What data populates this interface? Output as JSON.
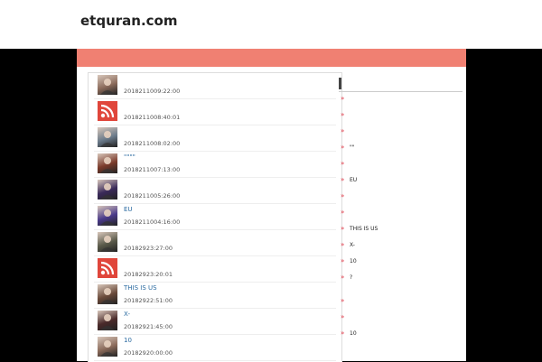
{
  "header": {
    "title": "etquran.com",
    "tagline": ""
  },
  "nav": [
    {
      "label": ""
    },
    {
      "label": ""
    },
    {
      "label": ""
    }
  ],
  "posts": [
    {
      "title": "",
      "date": " 2018211009:22:00 ",
      "thumb": "photo"
    },
    {
      "title": "",
      "date": " 2018211008:40:01 ",
      "thumb": "rss"
    },
    {
      "title": "",
      "date": " 2018211008:02:00 ",
      "thumb": "photo"
    },
    {
      "title": "\"\"\"\"",
      "date": " 2018211007:13:00 ",
      "thumb": "photo"
    },
    {
      "title": "",
      "date": " 2018211005:26:00 ",
      "thumb": "photo"
    },
    {
      "title": "EU",
      "date": " 2018211004:16:00 ",
      "thumb": "photo"
    },
    {
      "title": "",
      "date": " 20182923:27:00 ",
      "thumb": "photo"
    },
    {
      "title": "",
      "date": " 20182923:20:01 ",
      "thumb": "rss"
    },
    {
      "title": "THIS IS US",
      "date": " 20182922:51:00 ",
      "thumb": "photo"
    },
    {
      "title": "X-",
      "date": " 20182921:45:00 ",
      "thumb": "photo"
    },
    {
      "title": "10",
      "date": " 20182920:00:00 ",
      "thumb": "photo"
    }
  ],
  "sidebar": {
    "heading": "",
    "items": [
      {
        "label": ""
      },
      {
        "label": ""
      },
      {
        "label": ""
      },
      {
        "label": "\"\" "
      },
      {
        "label": ""
      },
      {
        "label": "EU"
      },
      {
        "label": ""
      },
      {
        "label": ""
      },
      {
        "label": "THIS IS US"
      },
      {
        "label": "X-"
      },
      {
        "label": "10"
      },
      {
        "label": "?"
      },
      {
        "label": ""
      },
      {
        "label": ""
      },
      {
        "label": "10"
      }
    ]
  },
  "colors": {
    "nav": "#f08072",
    "link": "#2a6aa0",
    "rss": "#e0463b",
    "chevron": "#dd2233",
    "page_bg": "#000000"
  }
}
